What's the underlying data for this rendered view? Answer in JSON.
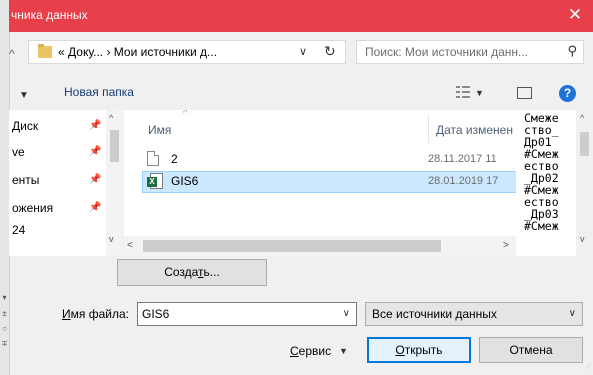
{
  "window": {
    "title": "чника данных",
    "close_glyph": "✕"
  },
  "edge": {
    "marks": [
      "▾",
      "±",
      "○",
      "∓"
    ]
  },
  "address_bar": {
    "back_glyph": "^",
    "path": "« Доку... › Мои источники д...",
    "dropdown_glyph": "∨",
    "refresh_glyph": "↻"
  },
  "search": {
    "placeholder": "Поиск: Мои источники данн...",
    "icon_glyph": "⚲"
  },
  "toolbar": {
    "organize_glyph": "▼",
    "new_folder": "Новая папка",
    "view_dropdown_glyph": "▼",
    "help": "?"
  },
  "nav_pane": {
    "items": [
      {
        "label": "Диск",
        "pin": "📌"
      },
      {
        "label": "ve",
        "pin": "📌"
      },
      {
        "label": "енты",
        "pin": "📌"
      },
      {
        "label": "ожения",
        "pin": "📌"
      },
      {
        "label": "24",
        "pin": ""
      }
    ],
    "scroll_up": "^",
    "scroll_down": "v"
  },
  "file_pane": {
    "sort_caret": "^",
    "columns": {
      "name": "Имя",
      "date": "Дата изменен"
    },
    "rows": [
      {
        "name": "2",
        "date": "28.11.2017 11",
        "selected": false
      },
      {
        "name": "GIS6",
        "date": "28.01.2019 17",
        "selected": true
      }
    ],
    "scroll_left": "<",
    "scroll_right": ">",
    "xls_badge": "X"
  },
  "preview": {
    "text": "Смеже ство_Др01 #Смеж ество _Др02 #Смеж ество _Др03 #Смеж",
    "scroll_up": "^",
    "scroll_down": "v"
  },
  "buttons": {
    "create_pre": "Созда",
    "create_ul": "т",
    "create_post": "ь...",
    "service_ul": "С",
    "service_post": "ервис",
    "service_dd": "▼",
    "open_ul": "О",
    "open_post": "ткрыть",
    "cancel": "Отмена"
  },
  "filename": {
    "label_ul": "И",
    "label_post": "мя файла:",
    "value": "GIS6",
    "dropdown_glyph": "∨"
  },
  "filter": {
    "value": "Все источники данных",
    "dropdown_glyph": "∨"
  },
  "colors": {
    "title_bar": "#e8404a",
    "selection": "#cce8ff",
    "primary_button_border": "#0078d7"
  }
}
